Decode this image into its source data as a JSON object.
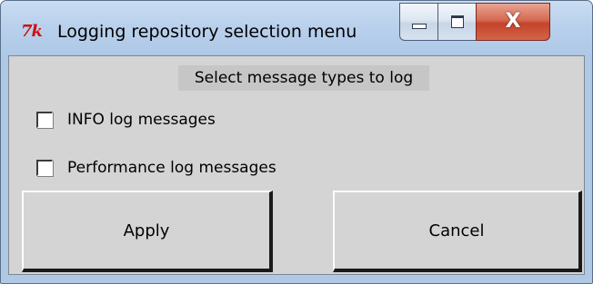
{
  "window": {
    "icon_text": "7k",
    "title": "Logging repository selection menu",
    "controls": {
      "minimize": "minimize-icon",
      "maximize": "maximize-icon",
      "close": "close-icon",
      "close_glyph": "X"
    }
  },
  "content": {
    "header": "Select message types to log",
    "options": [
      {
        "label": "INFO log messages",
        "checked": false
      },
      {
        "label": "Performance log messages",
        "checked": false
      }
    ],
    "buttons": {
      "apply": "Apply",
      "cancel": "Cancel"
    }
  },
  "colors": {
    "client_background": "#d4d4d4",
    "header_background": "#c6c6c6",
    "icon_red": "#cc1111"
  }
}
